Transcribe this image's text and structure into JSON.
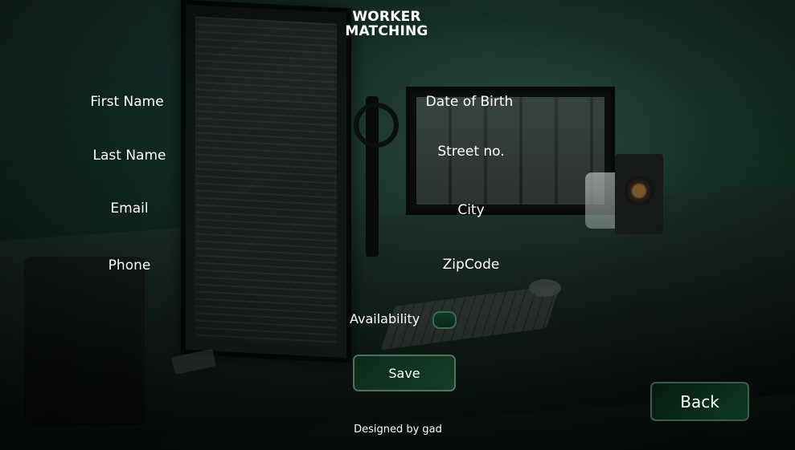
{
  "app": {
    "title_line1": "WORKER",
    "title_line2": "MATCHING"
  },
  "form": {
    "left_fields": [
      {
        "label": "First Name"
      },
      {
        "label": "Last Name"
      },
      {
        "label": "Email"
      },
      {
        "label": "Phone"
      }
    ],
    "right_fields": [
      {
        "label": "Date of Birth"
      },
      {
        "label": "Street no."
      },
      {
        "label": "City"
      },
      {
        "label": "ZipCode"
      }
    ],
    "availability": {
      "label": "Availability",
      "enabled": false
    },
    "save_label": "Save"
  },
  "navigation": {
    "back_label": "Back"
  },
  "footer": {
    "credit": "Designed by gad"
  },
  "colors": {
    "accent": "#123f25",
    "button_border": "#53705f",
    "text": "#ffffff"
  }
}
